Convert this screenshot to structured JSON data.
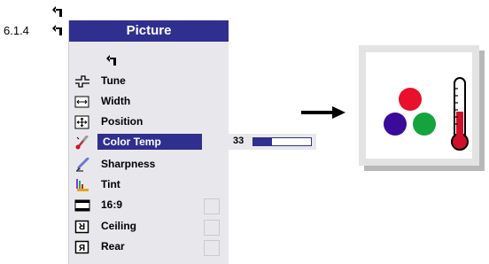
{
  "header": {
    "section_number": "6.1.4"
  },
  "menu": {
    "title": "Picture",
    "items": [
      {
        "label": "Tune",
        "icon": "tune-icon"
      },
      {
        "label": "Width",
        "icon": "width-icon"
      },
      {
        "label": "Position",
        "icon": "position-icon"
      },
      {
        "label": "Color Temp",
        "icon": "thermometer-icon",
        "selected": true
      },
      {
        "label": "Sharpness",
        "icon": "sharpness-icon"
      },
      {
        "label": "Tint",
        "icon": "tint-icon"
      },
      {
        "label": "16:9",
        "icon": "aspect-icon",
        "checkbox": true
      },
      {
        "label": "Ceiling",
        "icon": "ceiling-icon",
        "checkbox": true
      },
      {
        "label": "Rear",
        "icon": "rear-icon",
        "checkbox": true
      }
    ]
  },
  "value": {
    "number": "33",
    "level": 0.33
  },
  "colors": {
    "menu_header": "#2f2f8f",
    "red": "#e8102a",
    "purple": "#3a0a99",
    "green": "#14a33c"
  }
}
